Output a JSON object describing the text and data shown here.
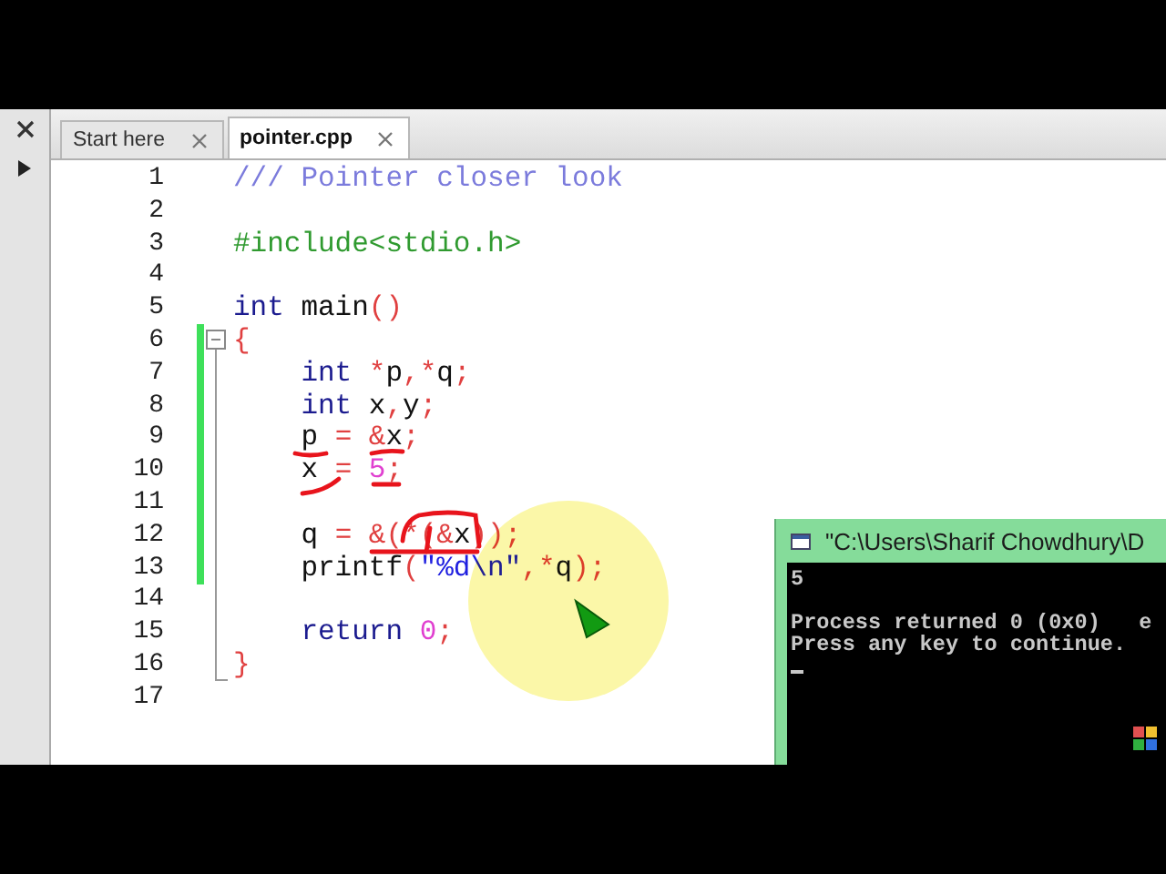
{
  "tabs": [
    {
      "label": "Start here",
      "selected": false
    },
    {
      "label": "pointer.cpp",
      "selected": true
    }
  ],
  "editor": {
    "lines": [
      {
        "number": "1",
        "modified": false,
        "foldable": false,
        "tokens": [
          {
            "kind": "comment",
            "text": "/// Pointer closer look"
          }
        ]
      },
      {
        "number": "2",
        "modified": false,
        "foldable": false
      },
      {
        "number": "3",
        "modified": false,
        "foldable": false,
        "tokens": [
          {
            "kind": "preproc",
            "text": "#include<stdio.h>"
          }
        ]
      },
      {
        "number": "4",
        "modified": false,
        "foldable": false
      },
      {
        "number": "5",
        "modified": false,
        "foldable": false,
        "tokens": [
          {
            "kind": "keyword",
            "text": "int"
          },
          {
            "kind": "plain",
            "text": " main"
          },
          {
            "kind": "op",
            "text": "()"
          }
        ]
      },
      {
        "number": "6",
        "modified": true,
        "foldable": true,
        "expanded": true,
        "tokens": [
          {
            "kind": "op",
            "text": "{"
          }
        ]
      },
      {
        "number": "7",
        "modified": true,
        "foldable": false,
        "tokens": [
          {
            "kind": "keyword",
            "text": "    int"
          },
          {
            "kind": "op",
            "text": " *"
          },
          {
            "kind": "plain",
            "text": "p"
          },
          {
            "kind": "op",
            "text": ",*"
          },
          {
            "kind": "plain",
            "text": "q"
          },
          {
            "kind": "op",
            "text": ";"
          }
        ]
      },
      {
        "number": "8",
        "modified": true,
        "foldable": false,
        "tokens": [
          {
            "kind": "keyword",
            "text": "    int"
          },
          {
            "kind": "plain",
            "text": " x"
          },
          {
            "kind": "op",
            "text": ","
          },
          {
            "kind": "plain",
            "text": "y"
          },
          {
            "kind": "op",
            "text": ";"
          }
        ]
      },
      {
        "number": "9",
        "modified": true,
        "foldable": false,
        "tokens": [
          {
            "kind": "plain",
            "text": "    p "
          },
          {
            "kind": "op",
            "text": "= &"
          },
          {
            "kind": "plain",
            "text": "x"
          },
          {
            "kind": "op",
            "text": ";"
          }
        ]
      },
      {
        "number": "10",
        "modified": true,
        "foldable": false,
        "tokens": [
          {
            "kind": "plain",
            "text": "    x "
          },
          {
            "kind": "op",
            "text": "="
          },
          {
            "kind": "number",
            "text": " 5"
          },
          {
            "kind": "op",
            "text": ";"
          }
        ]
      },
      {
        "number": "11",
        "modified": true,
        "foldable": false
      },
      {
        "number": "12",
        "modified": true,
        "foldable": false,
        "tokens": [
          {
            "kind": "plain",
            "text": "    q "
          },
          {
            "kind": "op",
            "text": "= &(*(&"
          },
          {
            "kind": "plain",
            "text": "x"
          },
          {
            "kind": "op",
            "text": "));"
          }
        ]
      },
      {
        "number": "13",
        "modified": true,
        "foldable": false,
        "tokens": [
          {
            "kind": "plain",
            "text": "    printf"
          },
          {
            "kind": "op",
            "text": "("
          },
          {
            "kind": "string",
            "text": "\"%d\\n\""
          },
          {
            "kind": "op",
            "text": ",*"
          },
          {
            "kind": "plain",
            "text": "q"
          },
          {
            "kind": "op",
            "text": ");"
          }
        ]
      },
      {
        "number": "14",
        "modified": false,
        "foldable": false
      },
      {
        "number": "15",
        "modified": false,
        "foldable": false,
        "tokens": [
          {
            "kind": "keyword",
            "text": "    return"
          },
          {
            "kind": "number",
            "text": " 0"
          },
          {
            "kind": "op",
            "text": ";"
          }
        ]
      },
      {
        "number": "16",
        "modified": false,
        "foldable": false,
        "fold_end": true,
        "tokens": [
          {
            "kind": "op",
            "text": "}"
          }
        ]
      },
      {
        "number": "17",
        "modified": false,
        "foldable": false
      }
    ]
  },
  "console": {
    "title": "\"C:\\Users\\Sharif Chowdhury\\D",
    "lines": [
      {
        "text": "5",
        "gap_after": true
      },
      {
        "text": "Process returned 0 (0x0)   e",
        "gap_after": false
      },
      {
        "text": "Press any key to continue.",
        "gap_after": false
      }
    ]
  }
}
